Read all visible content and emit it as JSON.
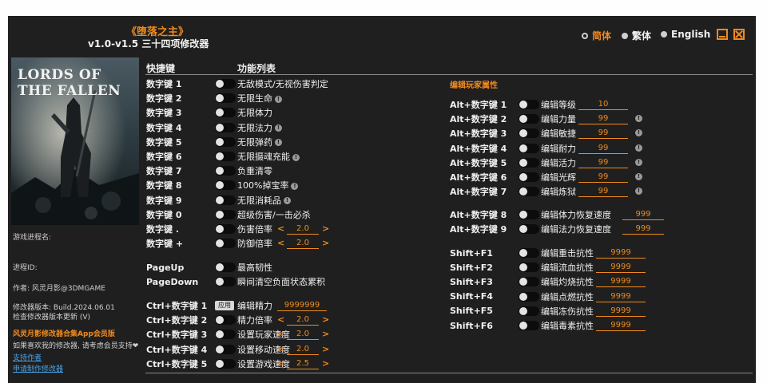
{
  "title": "《堕落之主》",
  "subtitle": "v1.0-v1.5 三十四项修改器",
  "languages": [
    {
      "label": "简体",
      "active": true
    },
    {
      "label": "繁体",
      "active": false
    },
    {
      "label": "English",
      "active": false
    }
  ],
  "cover": {
    "game_title": "LORDS OF THE FALLEN"
  },
  "sidebar": {
    "process_name_label": "游戏进程名:",
    "process_id_label": "进程ID:",
    "author": "作者: 风灵月影@3DMGAME",
    "version": "修改器版本: Build.2024.06.01",
    "check_update": "检查修改器版本更新 (V)",
    "member_link": "风灵月影修改器合集App会员版",
    "support_text": "如果喜欢我的修改器, 请考虑会员支持❤",
    "support_link": "支持作者",
    "request_link": "申请制作修改器"
  },
  "headers": {
    "hotkey": "快捷键",
    "features": "功能列表",
    "section_right": "编辑玩家属性"
  },
  "left_rows": [
    {
      "key": "数字键 1",
      "label": "无敌模式/无视伤害判定",
      "info": false
    },
    {
      "key": "数字键 2",
      "label": "无限生命",
      "info": true
    },
    {
      "key": "数字键 3",
      "label": "无限体力",
      "info": false
    },
    {
      "key": "数字键 4",
      "label": "无限法力",
      "info": true
    },
    {
      "key": "数字键 5",
      "label": "无限弹药",
      "info": true
    },
    {
      "key": "数字键 6",
      "label": "无限摄魂充能",
      "info": true
    },
    {
      "key": "数字键 7",
      "label": "负重清零",
      "info": false
    },
    {
      "key": "数字键 8",
      "label": "100%掉宝率",
      "info": true
    },
    {
      "key": "数字键 9",
      "label": "无限消耗品",
      "info": true
    },
    {
      "key": "数字键 0",
      "label": "超级伤害/一击必杀",
      "info": false
    },
    {
      "key": "数字键 .",
      "label": "伤害倍率",
      "info": false,
      "value": "2.0"
    },
    {
      "key": "数字键 +",
      "label": "防御倍率",
      "info": false,
      "value": "2.0"
    }
  ],
  "page_rows": [
    {
      "key": "PageUp",
      "label": "最高韧性"
    },
    {
      "key": "PageDown",
      "label": "瞬间清空负面状态累积"
    }
  ],
  "ctrl_rows": [
    {
      "key": "Ctrl+数字键 1",
      "label": "编辑精力",
      "value": "9999999",
      "apply": "应用"
    },
    {
      "key": "Ctrl+数字键 2",
      "label": "精力倍率",
      "value": "2.0"
    },
    {
      "key": "Ctrl+数字键 3",
      "label": "设置玩家速度",
      "value": "2.0"
    },
    {
      "key": "Ctrl+数字键 4",
      "label": "设置移动速度",
      "value": "2.0"
    },
    {
      "key": "Ctrl+数字键 5",
      "label": "设置游戏速度",
      "value": "2.5"
    }
  ],
  "alt_rows": [
    {
      "key": "Alt+数字键 1",
      "label": "编辑等级",
      "value": "10",
      "info": false
    },
    {
      "key": "Alt+数字键 2",
      "label": "编辑力量",
      "value": "99",
      "info": true
    },
    {
      "key": "Alt+数字键 3",
      "label": "编辑敏捷",
      "value": "99",
      "info": true
    },
    {
      "key": "Alt+数字键 4",
      "label": "编辑耐力",
      "value": "99",
      "info": true
    },
    {
      "key": "Alt+数字键 5",
      "label": "编辑活力",
      "value": "99",
      "info": true
    },
    {
      "key": "Alt+数字键 6",
      "label": "编辑光辉",
      "value": "99",
      "info": true
    },
    {
      "key": "Alt+数字键 7",
      "label": "编辑炼狱",
      "value": "99",
      "info": true
    },
    {
      "key": "Alt+数字键 8",
      "label": "编辑体力恢复速度",
      "value": "999",
      "info": false
    },
    {
      "key": "Alt+数字键 9",
      "label": "编辑法力恢复速度",
      "value": "999",
      "info": false
    }
  ],
  "shift_rows": [
    {
      "key": "Shift+F1",
      "label": "编辑重击抗性",
      "value": "9999"
    },
    {
      "key": "Shift+F2",
      "label": "编辑流血抗性",
      "value": "9999"
    },
    {
      "key": "Shift+F3",
      "label": "编辑灼烧抗性",
      "value": "9999"
    },
    {
      "key": "Shift+F4",
      "label": "编辑点燃抗性",
      "value": "9999"
    },
    {
      "key": "Shift+F5",
      "label": "编辑冻伤抗性",
      "value": "9999"
    },
    {
      "key": "Shift+F6",
      "label": "编辑毒素抗性",
      "value": "9999"
    }
  ],
  "colors": {
    "accent": "#f08a1e",
    "background": "#1f1f1f",
    "link": "#4aa3e8"
  }
}
